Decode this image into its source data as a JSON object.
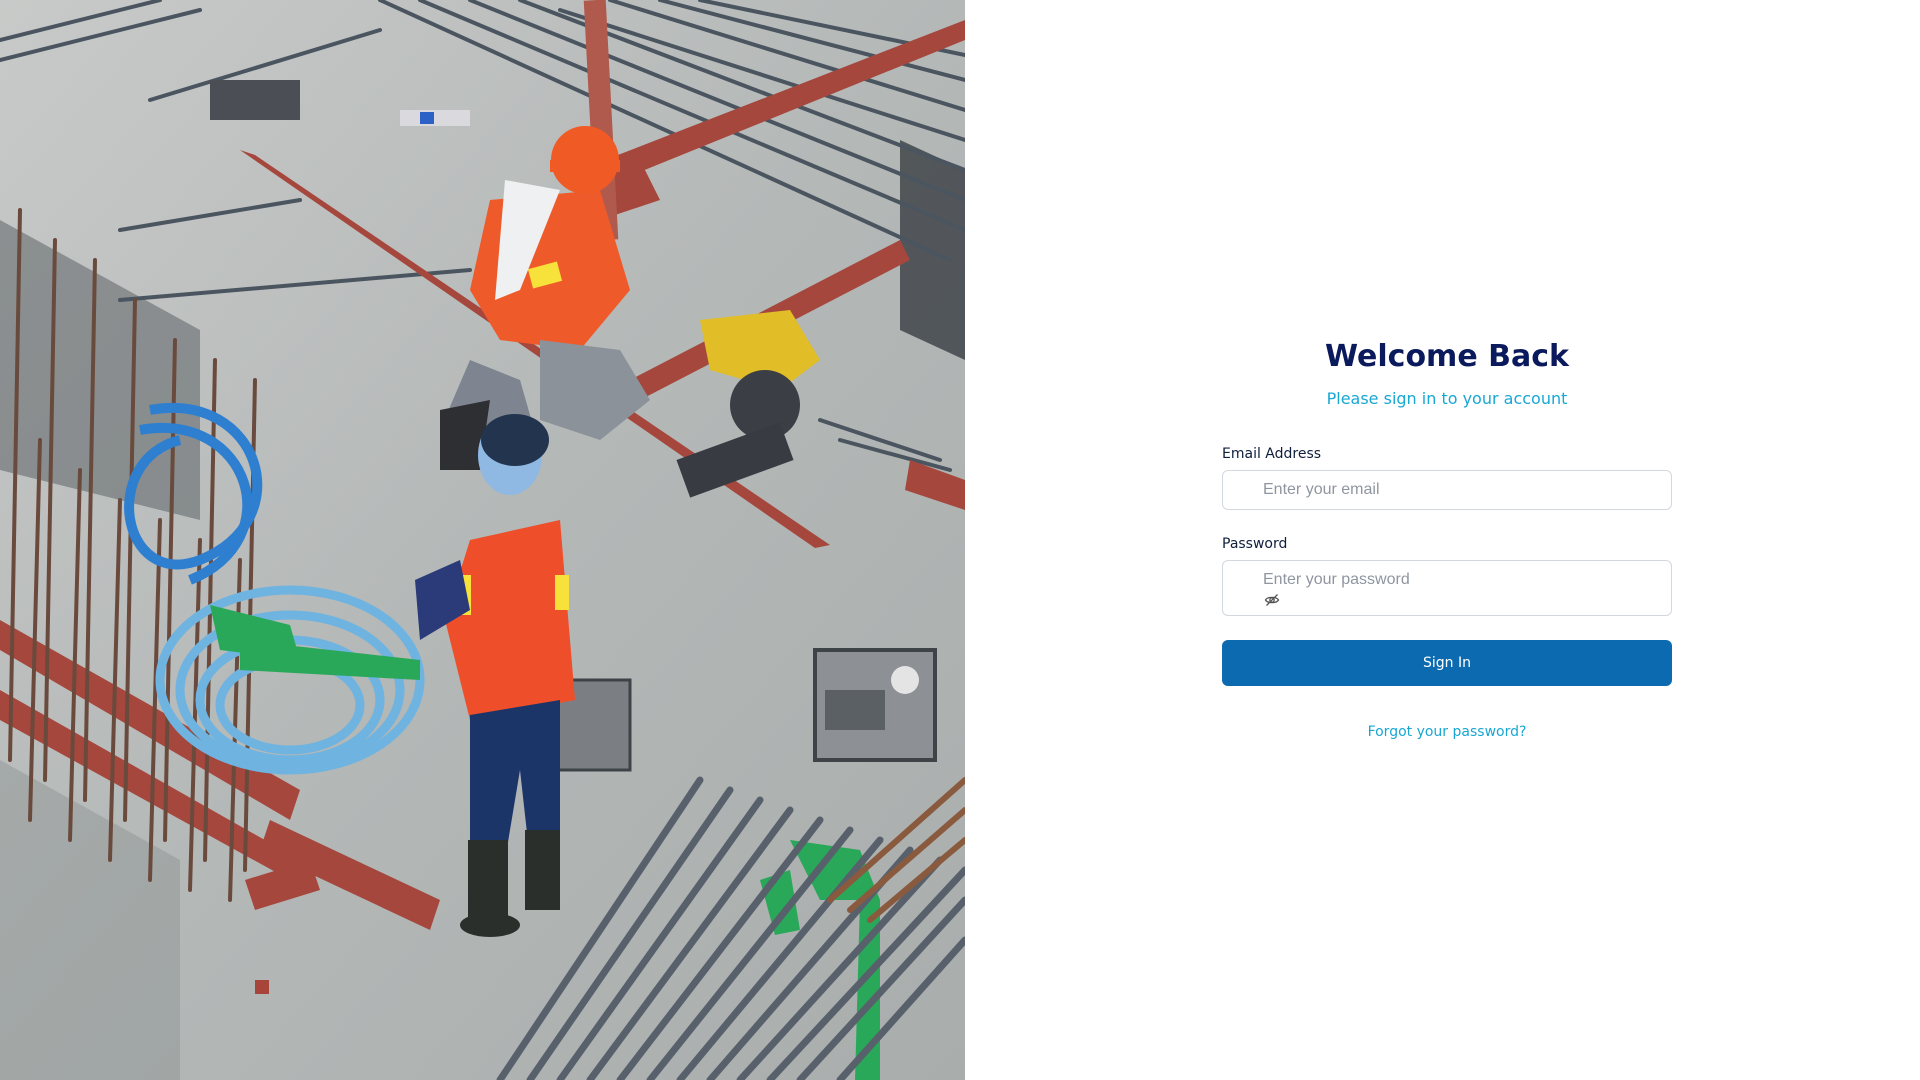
{
  "hero": {
    "image_name": "construction-workers-photo"
  },
  "login": {
    "title": "Welcome Back",
    "subtitle": "Please sign in to your account",
    "email": {
      "label": "Email Address",
      "placeholder": "Enter your email",
      "value": ""
    },
    "password": {
      "label": "Password",
      "placeholder": "Enter your password",
      "value": "",
      "toggle_icon": "eye-slash-icon"
    },
    "submit_label": "Sign In",
    "forgot_label": "Forgot your password?"
  },
  "colors": {
    "title": "#0b1a5c",
    "accent": "#18a7d3",
    "button": "#0b6ab0",
    "input_border": "#d3d8de"
  }
}
